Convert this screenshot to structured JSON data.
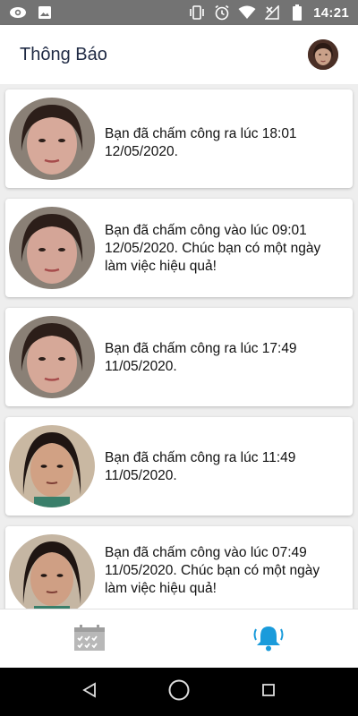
{
  "status_bar": {
    "time": "14:21",
    "left_icons": [
      "eye-icon",
      "image-icon"
    ],
    "right_icons": [
      "vibrate-icon",
      "alarm-icon",
      "wifi-icon",
      "no-signal-icon",
      "battery-icon"
    ]
  },
  "header": {
    "title": "Thông Báo"
  },
  "notifications": [
    {
      "message": "Bạn đã chấm công ra lúc 18:01 12/05/2020."
    },
    {
      "message": "Bạn đã chấm công vào lúc 09:01 12/05/2020. Chúc bạn có một ngày làm việc hiệu quả!"
    },
    {
      "message": "Bạn đã chấm công ra lúc 17:49 11/05/2020."
    },
    {
      "message": "Bạn đã chấm công ra lúc 11:49 11/05/2020."
    },
    {
      "message": "Bạn đã chấm công vào lúc 07:49 11/05/2020. Chúc bạn có một ngày làm việc hiệu quả!"
    }
  ],
  "bottom_nav": {
    "items": [
      {
        "icon": "calendar-icon",
        "active": false
      },
      {
        "icon": "bell-icon",
        "active": true
      }
    ]
  },
  "colors": {
    "accent": "#1a9bdb",
    "inactive": "#b0b0b0",
    "status_bar": "#737373"
  }
}
